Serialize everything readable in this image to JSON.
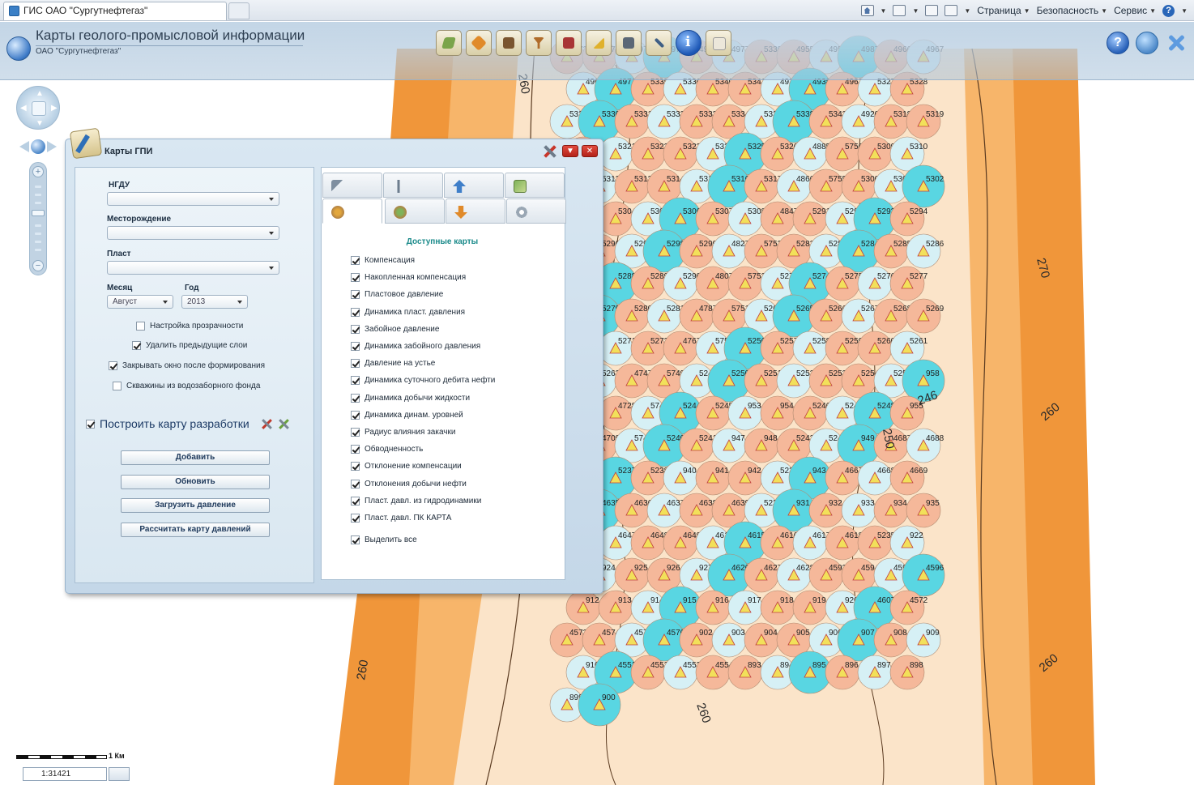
{
  "browser": {
    "tab_title": "ГИС ОАО \"Сургутнефтегаз\"",
    "menu": [
      "Страница",
      "Безопасность",
      "Сервис"
    ]
  },
  "app": {
    "title": "Карты геолого-промысловой информации",
    "subtitle": "ОАО \"Сургутнефтегаз\"",
    "toolbar": [
      "layers-icon",
      "edit-map-icon",
      "abc-labels-icon",
      "filter-icon",
      "book-icon",
      "measure-icon",
      "print-icon",
      "pen-icon",
      "info-icon",
      "document-icon"
    ],
    "header_right": [
      "help-icon",
      "search-icon",
      "close-icon"
    ]
  },
  "scale": {
    "label": "1 Км",
    "ratio": "1:31421"
  },
  "dialog": {
    "title": "Карты ГПИ",
    "ngdu_label": "НГДУ",
    "field_label": "Месторождение",
    "layer_label": "Пласт",
    "month_label": "Месяц",
    "month_value": "Август",
    "year_label": "Год",
    "year_value": "2013",
    "opt_transparency": "Настройка прозрачности",
    "opt_delete_layers": "Удалить предыдущие слои",
    "opt_close_after": "Закрывать окно после формирования",
    "opt_water_wells": "Скважины из водозаборного фонда",
    "build_map": "Построить карту разработки",
    "buttons": {
      "add": "Добавить",
      "refresh": "Обновить",
      "load_pressure": "Загрузить давление",
      "calc_pressure_map": "Рассчитать карту давлений"
    },
    "available_maps_heading": "Доступные карты",
    "maps": [
      "Компенсация",
      "Накопленная компенсация",
      "Пластовое давление",
      "Динамика пласт. давления",
      "Забойное давление",
      "Динамика забойного давления",
      "Давление на устье",
      "Динамика суточного дебита нефти",
      "Динамика добычи жидкости",
      "Динамика динам. уровней",
      "Радиус влияния закачки",
      "Обводненность",
      "Отклонение компенсации",
      "Отклонения добычи нефти",
      "Пласт. давл. из гидродинамики",
      "Пласт. давл. ПК КАРТА"
    ],
    "select_all": "Выделить все"
  },
  "map": {
    "contour_labels": [
      "260",
      "270",
      "260",
      "260",
      "260",
      "246",
      "250",
      "260"
    ],
    "well_labels": [
      "4972",
      "4973",
      "4974",
      "4975",
      "4976",
      "4977",
      "5339",
      "4955",
      "4956",
      "4987",
      "4966",
      "4967",
      "4969",
      "4971",
      "5335",
      "5336",
      "5340",
      "5341",
      "4937",
      "4938",
      "4963",
      "5327",
      "5328",
      "5329",
      "5330",
      "5331",
      "5332",
      "5333",
      "5334",
      "5337",
      "5338",
      "5342",
      "4920",
      "5318",
      "5319",
      "5320",
      "5321",
      "5322",
      "5323",
      "5324",
      "5325",
      "5326",
      "4885",
      "5756",
      "5309",
      "5310",
      "5311",
      "5312",
      "5313",
      "5314",
      "5315",
      "5316",
      "5317",
      "4866",
      "5755",
      "5300",
      "5301",
      "5302",
      "5303",
      "5304",
      "5305",
      "5306",
      "5307",
      "5308",
      "4847Гр",
      "5291",
      "5292",
      "5293",
      "5294",
      "5295",
      "5296",
      "5297",
      "5298",
      "5299",
      "4827",
      "5753",
      "5282",
      "5283",
      "5284",
      "5285",
      "5286",
      "5287",
      "5288",
      "5289",
      "5290",
      "4807",
      "5752",
      "5273",
      "5274",
      "5275",
      "5276",
      "5277",
      "5278",
      "5279",
      "5280",
      "5281",
      "4787",
      "5751",
      "5264",
      "5265",
      "5266",
      "5267",
      "5268",
      "5269",
      "5270",
      "5271",
      "5272",
      "4767",
      "5750",
      "5256",
      "5257",
      "5258",
      "5259",
      "5260",
      "5261",
      "5262",
      "5263",
      "4747",
      "5749",
      "5249",
      "5250",
      "5251",
      "5252",
      "5253",
      "5254",
      "5255",
      "958",
      "959",
      "4728",
      "5748",
      "5244",
      "5245",
      "953",
      "954",
      "5246",
      "5247",
      "5248",
      "955",
      "956",
      "4709",
      "5747",
      "5240",
      "5241",
      "947",
      "948",
      "5242",
      "5243",
      "949",
      "4687",
      "4688",
      "5746",
      "5237",
      "5238",
      "940",
      "941",
      "942",
      "5239",
      "943",
      "4667",
      "4668",
      "4669",
      "5745",
      "4635",
      "4636",
      "4637",
      "4638",
      "4639",
      "5236",
      "931",
      "932",
      "933",
      "934",
      "935",
      "936",
      "4647",
      "4648",
      "4649",
      "4614",
      "4615",
      "4616",
      "4617",
      "4618",
      "5235",
      "922",
      "923",
      "924",
      "925",
      "926",
      "927",
      "4626",
      "4627",
      "4628",
      "4593",
      "4594",
      "4595",
      "4596",
      "912",
      "913",
      "914",
      "915",
      "916",
      "917",
      "918",
      "919",
      "920",
      "4607",
      "4572",
      "4573",
      "4574",
      "4575",
      "4576",
      "902",
      "903",
      "904",
      "905",
      "906",
      "907",
      "908",
      "909",
      "910",
      "4551",
      "4552",
      "4553",
      "4554",
      "893",
      "894",
      "895",
      "896",
      "897",
      "898",
      "899",
      "900"
    ]
  },
  "colors": {
    "map_orange": "#f0963a",
    "map_pale": "#fbe4c9",
    "bubble_cyan": "#59d6e2",
    "bubble_pink": "#f5b89a",
    "bubble_lightblue": "#d6f0f5",
    "heading_teal": "#1a8a8a"
  }
}
